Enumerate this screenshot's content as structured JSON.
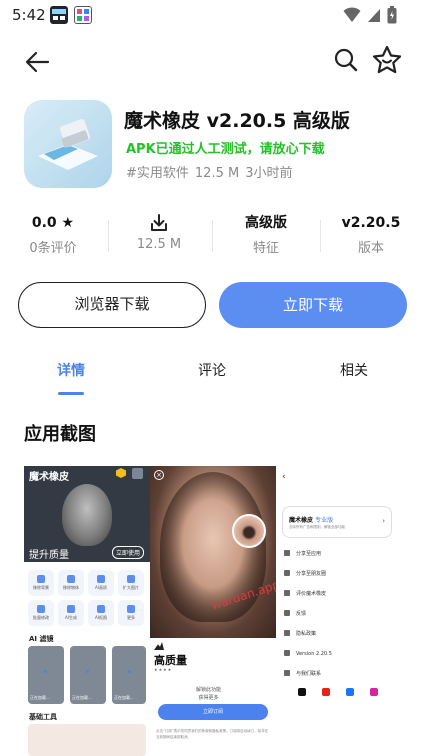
{
  "status_bar": {
    "time": "5:42",
    "icons": [
      "notification-app-icon",
      "notification-photo-icon",
      "wifi-icon",
      "signal-icon",
      "battery-icon"
    ]
  },
  "toolbar": {
    "back_icon": "arrow-left-icon",
    "search_icon": "search-icon",
    "favorite_icon": "star-smile-icon"
  },
  "app": {
    "title": "魔术橡皮 v2.20.5 高级版",
    "verified": "APK已通过人工测试，请放心下载",
    "category": "#实用软件",
    "size": "12.5 M",
    "updated": "3小时前"
  },
  "stats": [
    {
      "value": "0.0 ★",
      "label": "0条评价"
    },
    {
      "value": "",
      "label": "12.5 M"
    },
    {
      "value": "高级版",
      "label": "特征"
    },
    {
      "value": "v2.20.5",
      "label": "版本"
    }
  ],
  "buttons": {
    "browser_download": "浏览器下载",
    "download_now": "立即下载"
  },
  "tabs": [
    {
      "label": "详情",
      "active": true
    },
    {
      "label": "评论",
      "active": false
    },
    {
      "label": "相关",
      "active": false
    }
  ],
  "screenshots": {
    "section_title": "应用截图",
    "shot1": {
      "title": "魔术橡皮",
      "enhance": "提升质量",
      "pill": "立即使用",
      "tools": [
        "移除背景",
        "移除物体",
        "AI画质",
        "扩大图片",
        "批量修改",
        "AI生成",
        "AI抠图",
        "更多"
      ],
      "ai_section": "AI 滤镜",
      "card_caption": "正在加载...",
      "basic_section": "基础工具"
    },
    "shot2": {
      "watermark": "waruan.app",
      "heading": "高质量",
      "stars": "★★★★",
      "lines": [
        "解锁此功能",
        "获得更多"
      ],
      "cta": "立即订阅",
      "footer": "点击“订阅”表示您同意我们的条款和隐私政策。订阅将自动续订，除非在当前期间结束前取消。"
    },
    "shot3": {
      "card_title": "魔术橡皮",
      "card_badge": "专业版",
      "card_desc": "去除所有广告和限制，解锁全部功能",
      "rows": [
        "分享至应用",
        "分享至朋友圈",
        "评价魔术橡皮",
        "反馈",
        "隐私政策",
        "Version 2.20.5",
        "与我们联系"
      ]
    }
  }
}
